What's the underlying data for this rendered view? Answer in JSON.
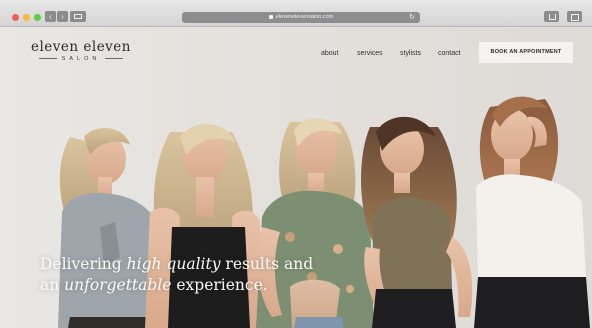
{
  "browser": {
    "url": "elevenelevensalon.com"
  },
  "site": {
    "logo_main": "eleven eleven",
    "logo_sub": "SALON",
    "nav": [
      "about",
      "services",
      "stylists",
      "contact"
    ],
    "cta": "BOOK AN APPOINTMENT"
  },
  "hero": {
    "tagline_1a": "Delivering ",
    "tagline_1b": "high quality",
    "tagline_1c": " results and",
    "tagline_2a": "an ",
    "tagline_2b": "unforgettable",
    "tagline_2c": " experience."
  }
}
